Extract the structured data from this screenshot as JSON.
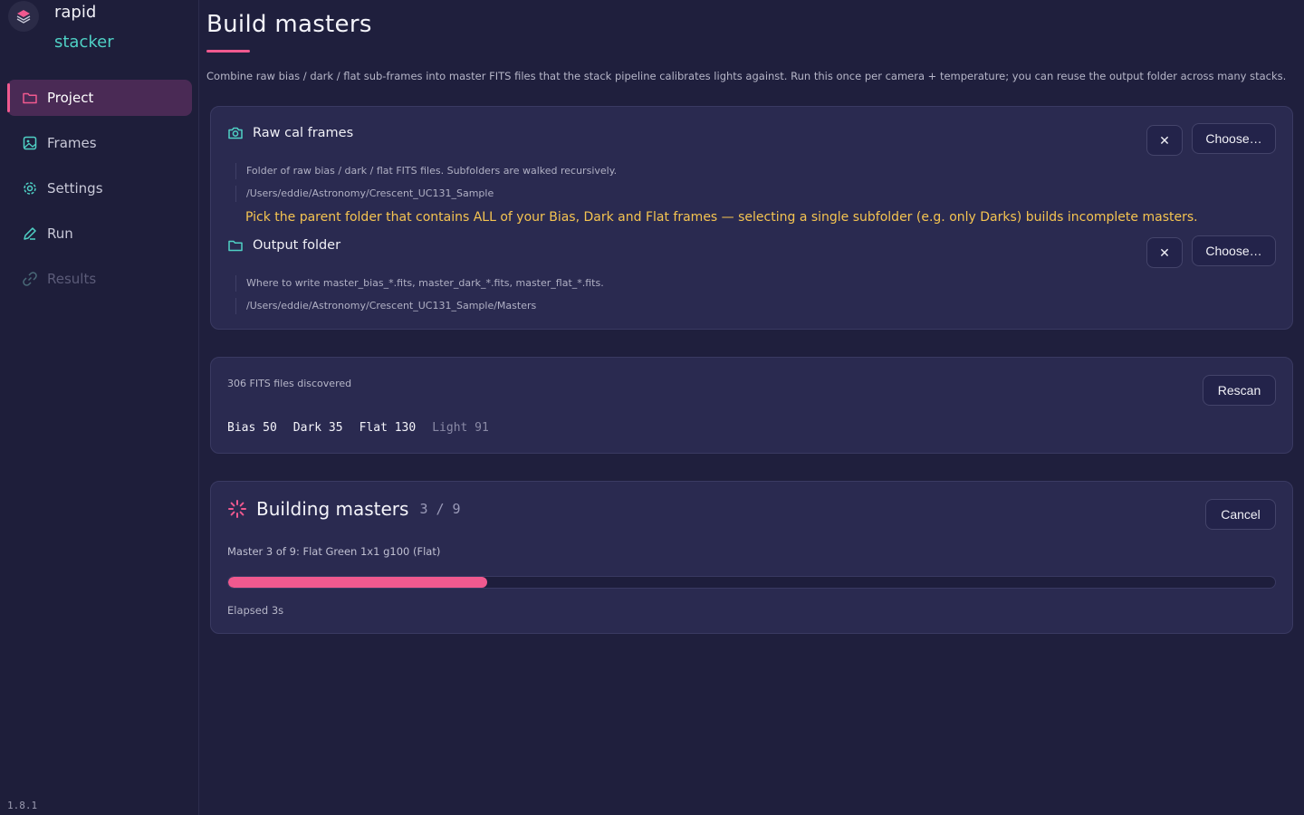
{
  "brand": {
    "line1": "rapid",
    "line2": "stacker"
  },
  "nav": [
    {
      "label": "Project",
      "state": "active"
    },
    {
      "label": "Frames",
      "state": "normal"
    },
    {
      "label": "Settings",
      "state": "normal"
    },
    {
      "label": "Run",
      "state": "normal"
    },
    {
      "label": "Results",
      "state": "disabled"
    }
  ],
  "version": "1.8.1",
  "page": {
    "title": "Build masters",
    "description": "Combine raw bias / dark / flat sub-frames into master FITS files that the stack pipeline calibrates lights against. Run this once per camera + temperature; you can reuse the output folder across many stacks."
  },
  "raw": {
    "title": "Raw cal frames",
    "hint": "Folder of raw bias / dark / flat FITS files. Subfolders are walked recursively.",
    "path": "/Users/eddie/Astronomy/Crescent_UC131_Sample",
    "warning": "Pick the parent folder that contains ALL of your Bias, Dark and Flat frames — selecting a single subfolder (e.g. only Darks) builds incomplete masters.",
    "clear_label": "✕",
    "choose_label": "Choose…"
  },
  "output": {
    "title": "Output folder",
    "hint": "Where to write master_bias_*.fits, master_dark_*.fits, master_flat_*.fits.",
    "path": "/Users/eddie/Astronomy/Crescent_UC131_Sample/Masters",
    "clear_label": "✕",
    "choose_label": "Choose…"
  },
  "scan": {
    "summary": "306 FITS files discovered",
    "rescan_label": "Rescan",
    "counts": [
      {
        "text": "Bias 50",
        "dim": false
      },
      {
        "text": "Dark 35",
        "dim": false
      },
      {
        "text": "Flat 130",
        "dim": false
      },
      {
        "text": "Light 91",
        "dim": true
      }
    ]
  },
  "build": {
    "title": "Building masters",
    "progress_text": "3 / 9",
    "progress_fraction": 0.247,
    "status": "Master 3 of 9: Flat Green 1x1 g100 (Flat)",
    "elapsed": "Elapsed 3s",
    "cancel_label": "Cancel"
  },
  "colors": {
    "accent": "#f0598f",
    "teal": "#4fd1c5",
    "warning": "#f5c451",
    "background": "#1f1f3d",
    "card": "#2a2a50"
  }
}
